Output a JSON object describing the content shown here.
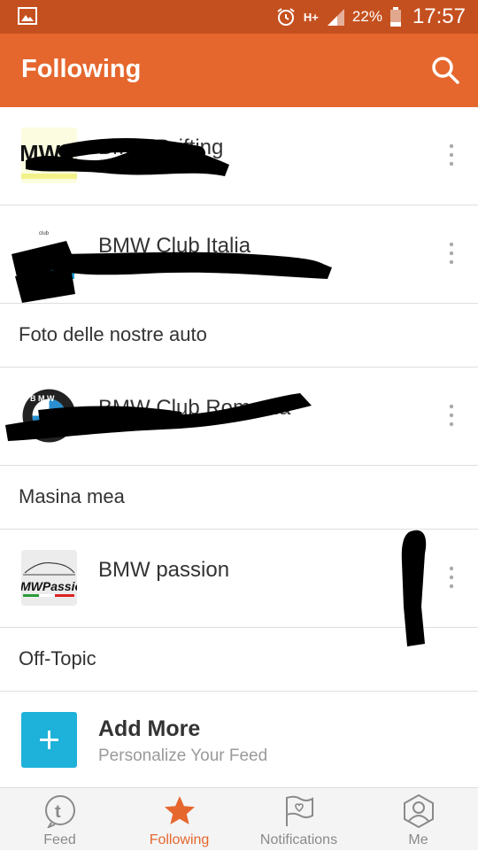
{
  "status_bar": {
    "network": "H+",
    "battery": "22%",
    "time": "17:57"
  },
  "app_bar": {
    "title": "Following"
  },
  "list": {
    "items": [
      {
        "kind": "group",
        "name": "BMW Drifting",
        "thumb": "bmw-logo-thumb",
        "redacted": true
      },
      {
        "kind": "group",
        "name": "BMW Club Italia",
        "thumb": "club-logo-thumb",
        "redacted": true
      },
      {
        "kind": "subforum",
        "name": "Foto delle nostre auto"
      },
      {
        "kind": "group",
        "name": "BMW Club Romania",
        "thumb": "bmw-roundel-thumb",
        "redacted": true
      },
      {
        "kind": "subforum",
        "name": "Masina mea"
      },
      {
        "kind": "group",
        "name": "BMW passion",
        "thumb": "bmw-passion-thumb",
        "redacted": false
      },
      {
        "kind": "subforum",
        "name": "Off-Topic"
      }
    ]
  },
  "add_more": {
    "title": "Add More",
    "subtitle": "Personalize Your Feed"
  },
  "tabs": [
    {
      "label": "Feed",
      "icon": "feed-icon",
      "active": false
    },
    {
      "label": "Following",
      "icon": "star-icon",
      "active": true
    },
    {
      "label": "Notifications",
      "icon": "flag-icon",
      "active": false
    },
    {
      "label": "Me",
      "icon": "user-icon",
      "active": false
    }
  ],
  "colors": {
    "status_bar": "#c5501f",
    "app_bar": "#e5672e",
    "accent": "#e5672e",
    "add_button": "#1eb1d9"
  }
}
